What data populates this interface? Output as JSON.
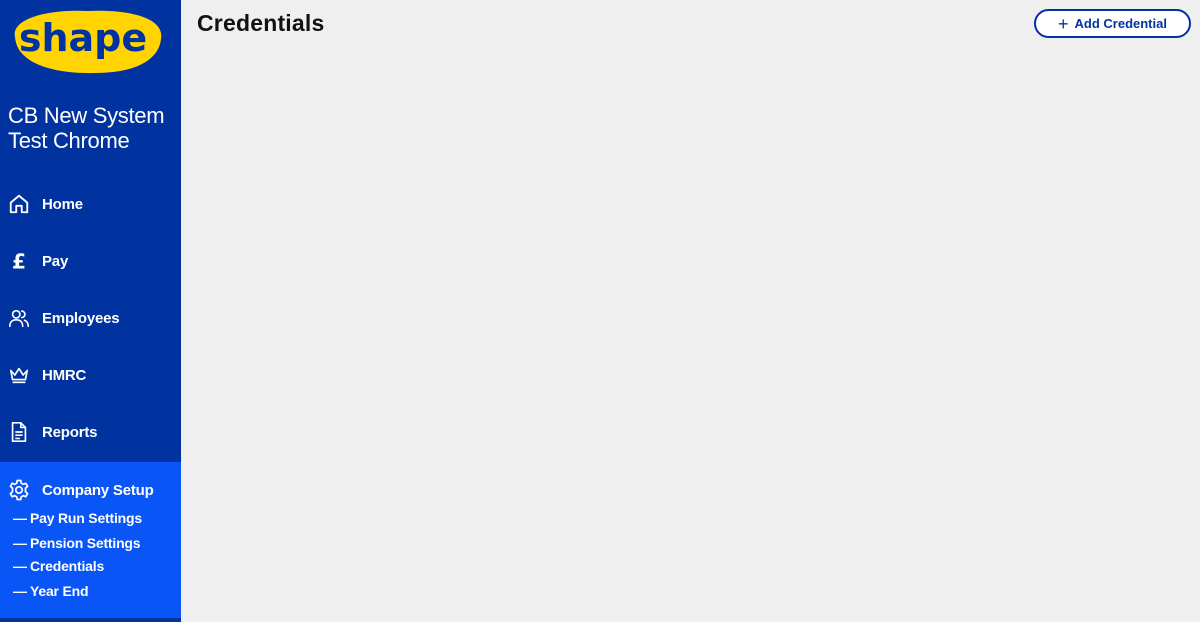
{
  "logo": {
    "text": "shape",
    "tm": "™"
  },
  "company": {
    "name": "CB New System Test Chrome"
  },
  "nav": {
    "home": "Home",
    "pay": "Pay",
    "employees": "Employees",
    "hmrc": "HMRC",
    "reports": "Reports",
    "company_setup": "Company Setup"
  },
  "setup_sub": {
    "pay_run_settings": "Pay Run Settings",
    "pension_settings": "Pension Settings",
    "credentials": "Credentials",
    "year_end": "Year End",
    "dash": "—"
  },
  "page": {
    "title": "Credentials"
  },
  "actions": {
    "add_label": "Add Credential",
    "plus": "+"
  },
  "colors": {
    "sidebar": "#0033a0",
    "active_section": "#0a55f5",
    "logo_yellow": "#ffd400",
    "background": "#efefef"
  }
}
